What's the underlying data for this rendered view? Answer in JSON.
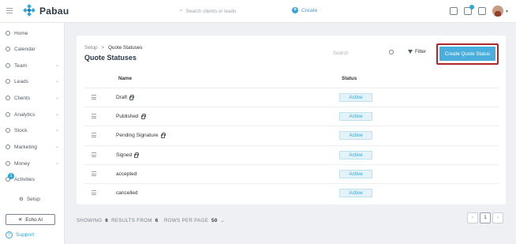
{
  "header": {
    "logo_text": "Pabau",
    "search_placeholder": "Search clients or leads",
    "create_label": "Create"
  },
  "sidebar": {
    "items": [
      {
        "label": "Home",
        "chevron": false
      },
      {
        "label": "Calendar",
        "chevron": false
      },
      {
        "label": "Team",
        "chevron": true
      },
      {
        "label": "Leads",
        "chevron": true
      },
      {
        "label": "Clients",
        "chevron": true
      },
      {
        "label": "Analytics",
        "chevron": true
      },
      {
        "label": "Stock",
        "chevron": true
      },
      {
        "label": "Marketing",
        "chevron": true
      },
      {
        "label": "Money",
        "chevron": true
      },
      {
        "label": "Activities",
        "chevron": false
      }
    ],
    "activities_badge": "1",
    "setup_label": "Setup",
    "echo_label": "Echo AI",
    "support_label": "Support"
  },
  "main": {
    "breadcrumb": {
      "root": "Setup",
      "separator": ">",
      "current": "Quote Statuses"
    },
    "title": "Quote Statuses",
    "search_placeholder": "Search",
    "filter_label": "Filter",
    "create_button": "Create Quote Status",
    "columns": {
      "name": "Name",
      "status": "Status"
    },
    "rows": [
      {
        "name": "Draft",
        "locked": true,
        "status": "Active"
      },
      {
        "name": "Published",
        "locked": true,
        "status": "Active"
      },
      {
        "name": "Pending Signature",
        "locked": true,
        "status": "Active"
      },
      {
        "name": "Signed",
        "locked": true,
        "status": "Active"
      },
      {
        "name": "accepted",
        "locked": false,
        "status": "Active"
      },
      {
        "name": "cancelled",
        "locked": false,
        "status": "Active"
      }
    ]
  },
  "footer": {
    "showing_prefix": "SHOWING",
    "showing_count": "6",
    "results_from": "RESULTS FROM",
    "total": "6",
    "rows_per_page_label": "ROWS PER PAGE",
    "rows_per_page_value": "50",
    "current_page": "1"
  },
  "colors": {
    "accent": "#49aedb",
    "highlight_border": "#b12727",
    "status_bg": "#e4f3fa"
  }
}
